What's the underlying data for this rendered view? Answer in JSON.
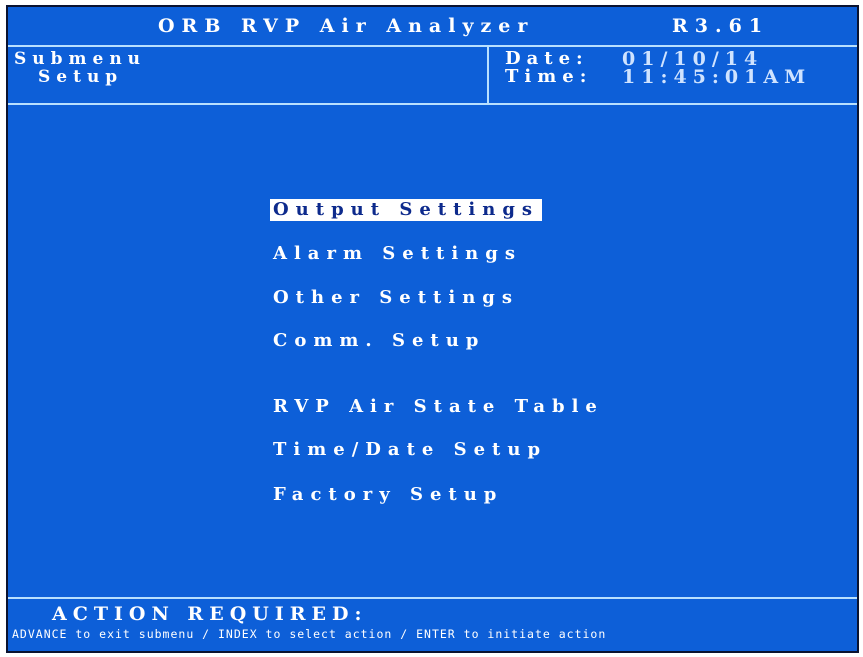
{
  "header": {
    "title": "ORB RVP Air Analyzer",
    "version": "R3.61"
  },
  "subheader": {
    "line1": "Submenu",
    "line2": "Setup",
    "date_label": "Date:",
    "date_value": "01/10/14",
    "time_label": "Time:",
    "time_value": "11:45:01AM"
  },
  "menu": {
    "items": [
      {
        "label": "Output Settings",
        "selected": true
      },
      {
        "label": "Alarm Settings",
        "selected": false
      },
      {
        "label": "Other Settings",
        "selected": false
      },
      {
        "label": "Comm. Setup",
        "selected": false
      },
      {
        "label": "RVP Air State Table",
        "selected": false
      },
      {
        "label": "Time/Date Setup",
        "selected": false
      },
      {
        "label": "Factory Setup",
        "selected": false
      }
    ]
  },
  "footer": {
    "action_title": "ACTION REQUIRED:",
    "help_text": "ADVANCE to exit submenu / INDEX to select action / ENTER to initiate action"
  },
  "colors": {
    "background": "#0d5fd8",
    "border": "#b8e0ff",
    "highlight": "#ffffff",
    "highlight_text": "#0d2a8c"
  }
}
